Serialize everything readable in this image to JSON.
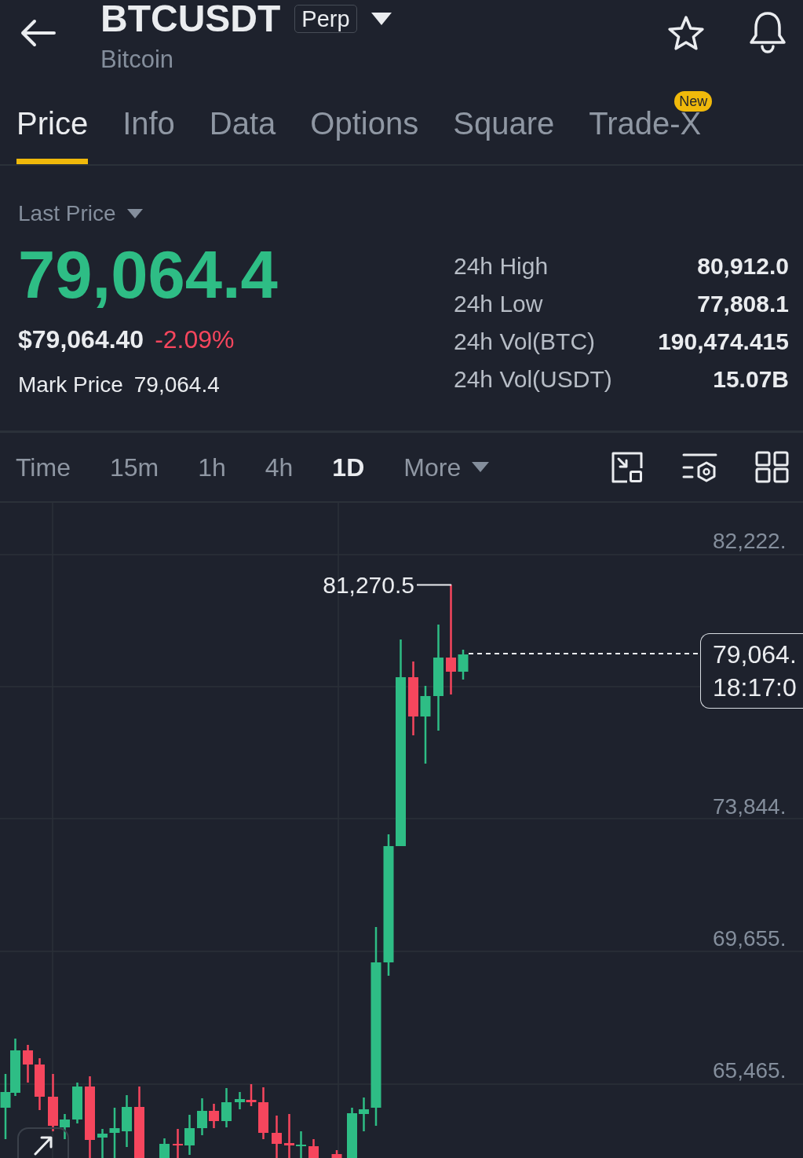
{
  "header": {
    "symbol": "BTCUSDT",
    "contract_badge": "Perp",
    "name": "Bitcoin"
  },
  "tabs": [
    {
      "label": "Price",
      "selected": true
    },
    {
      "label": "Info",
      "selected": false
    },
    {
      "label": "Data",
      "selected": false
    },
    {
      "label": "Options",
      "selected": false
    },
    {
      "label": "Square",
      "selected": false
    },
    {
      "label": "Trade-X",
      "selected": false,
      "badge": "New"
    }
  ],
  "ticker": {
    "price_type": "Last Price",
    "last_price": "79,064.4",
    "price_rising": true,
    "usd_price": "$79,064.40",
    "change": "-2.09%",
    "change_rising": false,
    "mark_price": {
      "label": "Mark Price",
      "value": "79,064.4"
    },
    "stats": [
      {
        "label": "24h High",
        "value": "80,912.0"
      },
      {
        "label": "24h Low",
        "value": "77,808.1"
      },
      {
        "label": "24h Vol(BTC)",
        "value": "190,474.415"
      },
      {
        "label": "24h Vol(USDT)",
        "value": "15.07B"
      }
    ]
  },
  "chart_toolbar": {
    "intervals": [
      {
        "label": "Time",
        "selected": false
      },
      {
        "label": "15m",
        "selected": false
      },
      {
        "label": "1h",
        "selected": false
      },
      {
        "label": "4h",
        "selected": false
      },
      {
        "label": "1D",
        "selected": true
      }
    ],
    "more": "More"
  },
  "chart": {
    "y_axis_labels": [
      "82,222.",
      "73,844.",
      "69,655.",
      "65,465."
    ],
    "high_marker": "81,270.5",
    "price_tag": {
      "price": "79,064.",
      "time": "18:17:0"
    }
  }
}
